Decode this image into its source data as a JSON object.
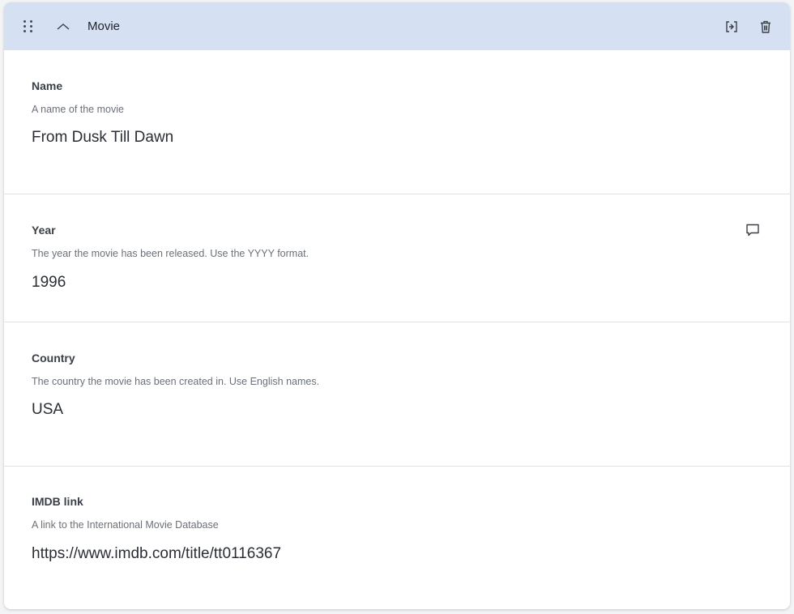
{
  "block": {
    "title": "Movie",
    "icons": {
      "drag": "drag-handle-icon",
      "collapse": "chevron-up-icon",
      "duplicate": "duplicate-icon",
      "delete": "trash-icon",
      "comment": "comment-icon"
    }
  },
  "fields": [
    {
      "label": "Name",
      "description": "A name of the movie",
      "value": "From Dusk Till Dawn"
    },
    {
      "label": "Year",
      "description": "The year the movie has been released. Use the YYYY format.",
      "value": "1996"
    },
    {
      "label": "Country",
      "description": "The country the movie has been created in. Use English names.",
      "value": "USA"
    },
    {
      "label": "IMDB link",
      "description": "A link to the International Movie Database",
      "value": "https://www.imdb.com/title/tt0116367"
    }
  ],
  "colors": {
    "header_bg": "#d5e1f3",
    "divider": "#dfe2e7"
  }
}
